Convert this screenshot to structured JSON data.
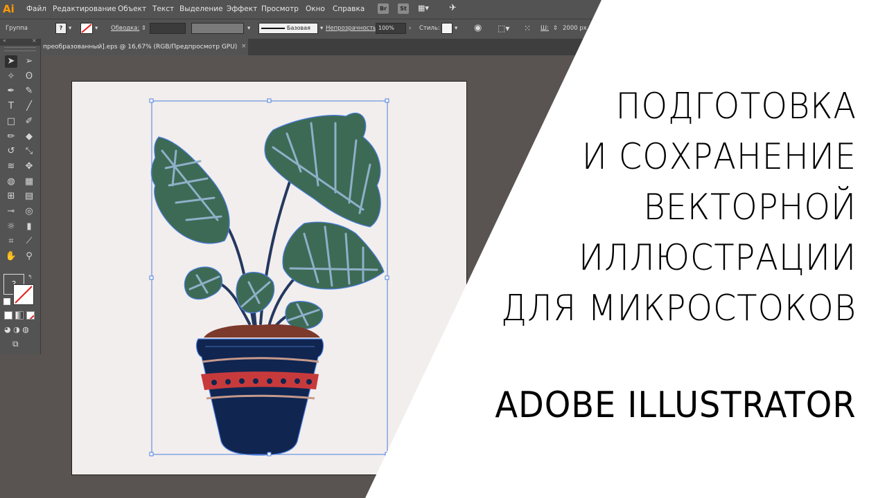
{
  "app": {
    "logo": "Ai",
    "menu": [
      "Файл",
      "Редактирование",
      "Объект",
      "Текст",
      "Выделение",
      "Эффект",
      "Просмотр",
      "Окно",
      "Справка"
    ],
    "badges": [
      "Br",
      "St"
    ]
  },
  "control_bar": {
    "selection_type": "Группа",
    "stroke_label": "Обводка:",
    "brush_label": "Базовая",
    "opacity_label": "Непрозрачность:",
    "opacity_value": "100%",
    "style_label": "Стиль:",
    "width_label": "Ш:",
    "width_value": "2000 px",
    "question_mark": "?"
  },
  "document": {
    "tab_title": "преобразованный].eps @ 16,67% (RGB/Предпросмотр GPU)",
    "close_glyph": "×"
  },
  "tools": [
    {
      "name": "selection-tool-icon",
      "glyph": "➤"
    },
    {
      "name": "direct-selection-tool-icon",
      "glyph": "➢"
    },
    {
      "name": "magic-wand-icon",
      "glyph": "✧"
    },
    {
      "name": "lasso-icon",
      "glyph": "ʘ"
    },
    {
      "name": "pen-tool-icon",
      "glyph": "✒"
    },
    {
      "name": "curvature-icon",
      "glyph": "✎"
    },
    {
      "name": "type-tool-icon",
      "glyph": "T"
    },
    {
      "name": "line-tool-icon",
      "glyph": "╱"
    },
    {
      "name": "rectangle-tool-icon",
      "glyph": "□"
    },
    {
      "name": "paintbrush-icon",
      "glyph": "✐"
    },
    {
      "name": "shaper-icon",
      "glyph": "✏"
    },
    {
      "name": "eraser-icon",
      "glyph": "◆"
    },
    {
      "name": "rotate-tool-icon",
      "glyph": "↺"
    },
    {
      "name": "scale-tool-icon",
      "glyph": "⤡"
    },
    {
      "name": "warp-tool-icon",
      "glyph": "≋"
    },
    {
      "name": "puppet-warp-icon",
      "glyph": "✥"
    },
    {
      "name": "shape-builder-icon",
      "glyph": "◍"
    },
    {
      "name": "perspective-grid-icon",
      "glyph": "▦"
    },
    {
      "name": "mesh-tool-icon",
      "glyph": "⊞"
    },
    {
      "name": "gradient-tool-icon",
      "glyph": "▤"
    },
    {
      "name": "eyedropper-icon",
      "glyph": "⊸"
    },
    {
      "name": "blend-tool-icon",
      "glyph": "◎"
    },
    {
      "name": "symbol-sprayer-icon",
      "glyph": "☼"
    },
    {
      "name": "column-graph-icon",
      "glyph": "▮"
    },
    {
      "name": "artboard-tool-icon",
      "glyph": "⌗"
    },
    {
      "name": "slice-tool-icon",
      "glyph": "⟋"
    },
    {
      "name": "hand-tool-icon",
      "glyph": "✋"
    },
    {
      "name": "zoom-tool-icon",
      "glyph": "⚲"
    }
  ],
  "fill_stroke": {
    "fill_glyph": "?"
  },
  "title": {
    "lines": [
      "ПОДГОТОВКА",
      "И СОХРАНЕНИЕ",
      "ВЕКТОРНОЙ",
      "ИЛЛЮСТРАЦИИ",
      "ДЛЯ МИКРОСТОКОВ"
    ],
    "subtitle": "ADOBE ILLUSTRATOR"
  },
  "colors": {
    "leaf": "#3d6a55",
    "vein": "#8fb0c8",
    "selection": "#4a7fe0",
    "pot": "#102550",
    "pot_band": "#c73a3c",
    "pot_stripe": "#c79a8c",
    "soil": "#7b3a2c",
    "artboard": "#f2eeed"
  }
}
